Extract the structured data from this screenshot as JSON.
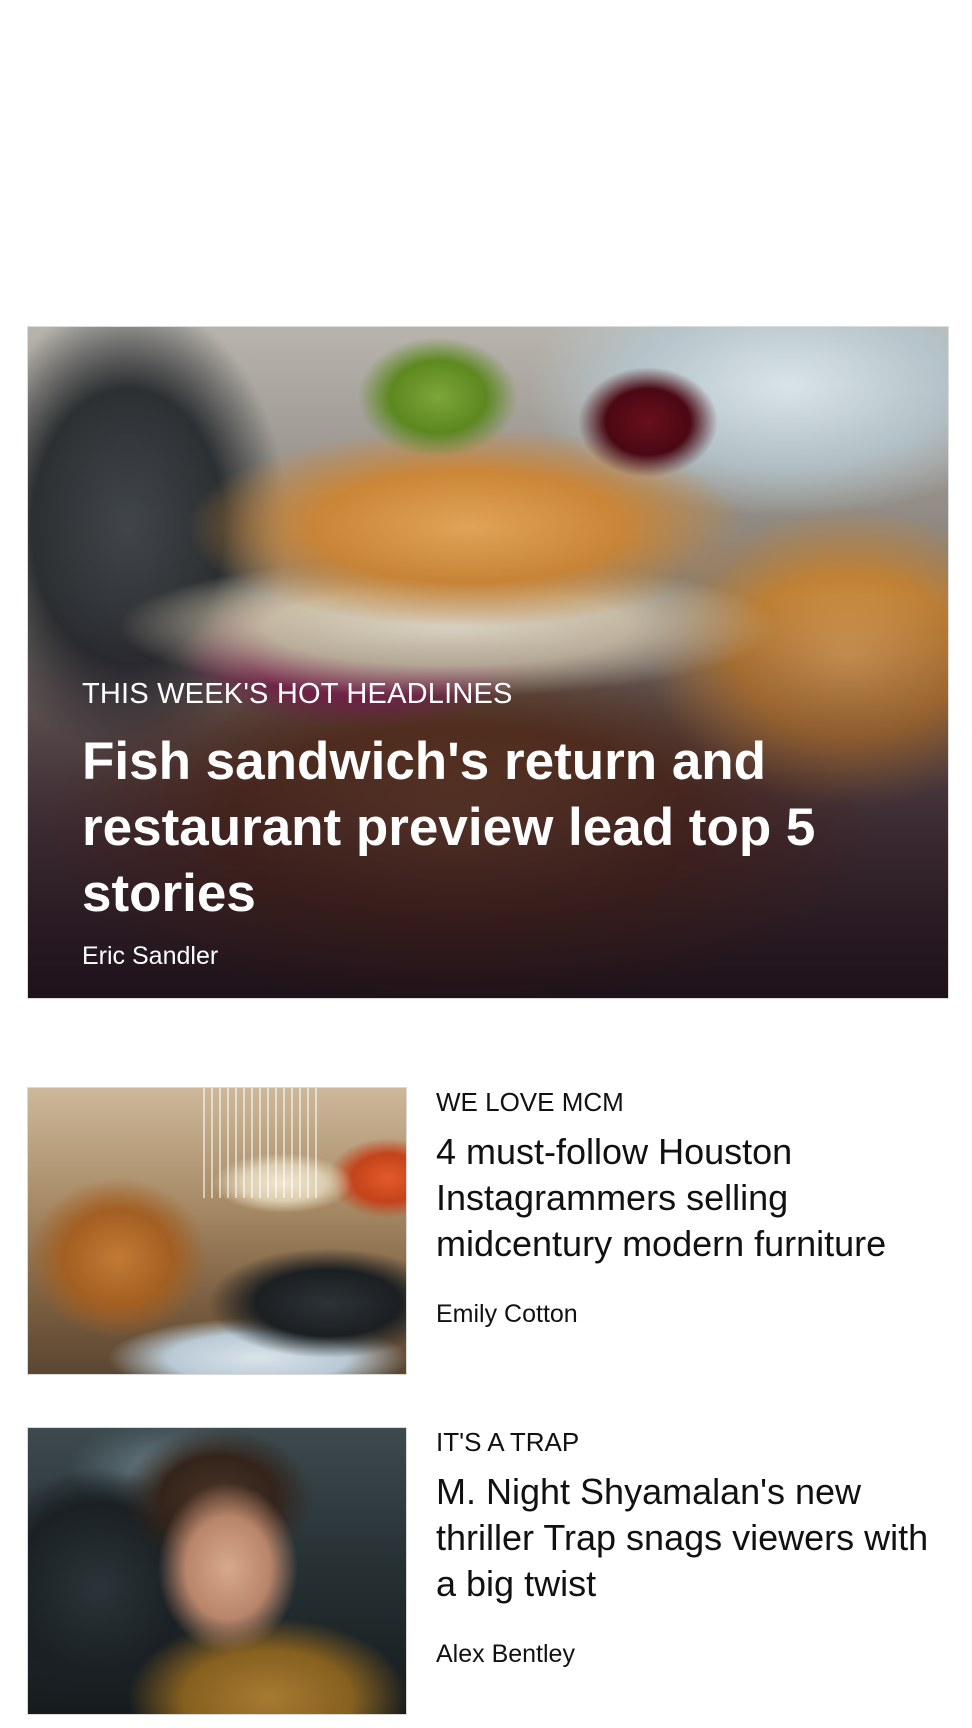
{
  "hero": {
    "kicker": "THIS WEEK'S HOT HEADLINES",
    "headline": "Fish sandwich's return and restaurant preview lead top 5 stories",
    "byline": "Eric Sandler"
  },
  "stories": [
    {
      "kicker": "WE LOVE MCM",
      "headline": "4 must-follow Houston Instagrammers selling midcentury modern furniture",
      "byline": "Emily Cotton"
    },
    {
      "kicker": "IT'S A TRAP",
      "headline": "M. Night Shyamalan's new thriller Trap snags viewers with a big twist",
      "byline": "Alex Bentley"
    }
  ]
}
